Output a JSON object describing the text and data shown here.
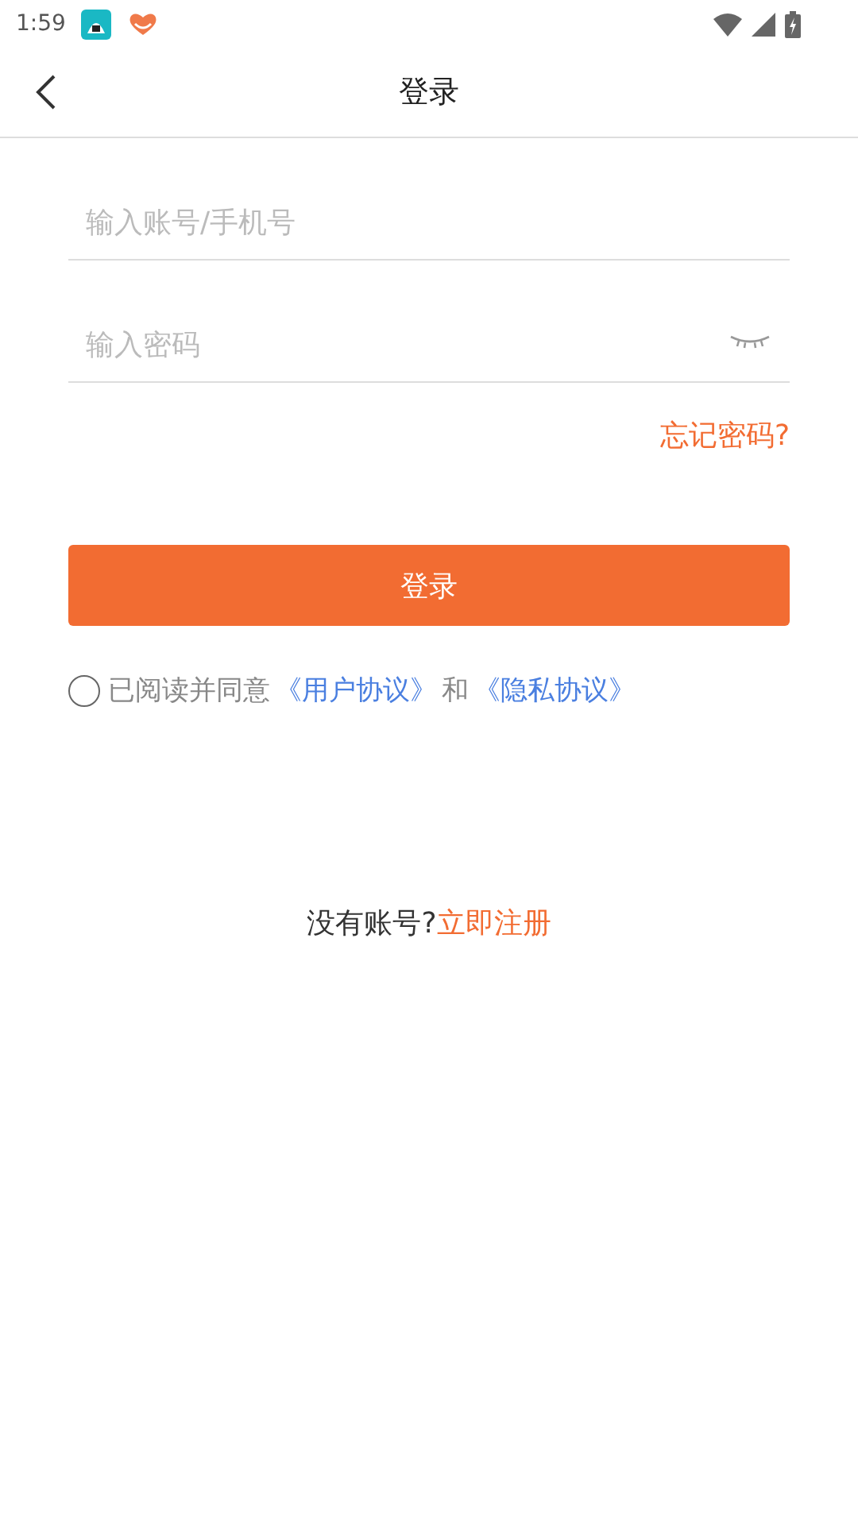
{
  "status_bar": {
    "time": "1:59"
  },
  "toolbar": {
    "title": "登录"
  },
  "account_field": {
    "placeholder": "输入账号/手机号"
  },
  "password_field": {
    "placeholder": "输入密码",
    "visible": false
  },
  "forgot_link": "忘记密码?",
  "login_button": "登录",
  "agreement": {
    "checked": false,
    "parts": [
      {
        "kind": "text",
        "text": "已阅读并同意"
      },
      {
        "kind": "link",
        "text": "《用户协议》"
      },
      {
        "kind": "text",
        "text": "和"
      },
      {
        "kind": "link",
        "text": "《隐私协议》"
      }
    ]
  },
  "register": {
    "prompt": "没有账号?",
    "link": "立即注册"
  }
}
